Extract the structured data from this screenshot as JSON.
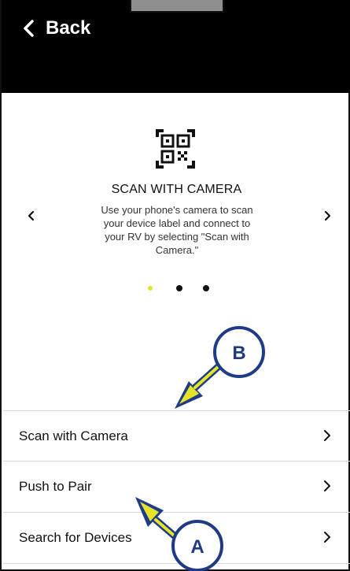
{
  "header": {
    "back_label": "Back"
  },
  "carousel": {
    "title": "SCAN WITH CAMERA",
    "description": "Use your phone's camera to scan your device label and connect to your RV by selecting \"Scan with Camera.\"",
    "active_index": 0,
    "total": 3
  },
  "options": [
    {
      "label": "Scan with Camera"
    },
    {
      "label": "Push to Pair"
    },
    {
      "label": "Search for Devices"
    }
  ],
  "callouts": {
    "a": "A",
    "b": "B"
  },
  "colors": {
    "callout_fill": "#ffffff",
    "callout_stroke": "#1f3b87",
    "callout_arrow": "#e4e52a"
  }
}
